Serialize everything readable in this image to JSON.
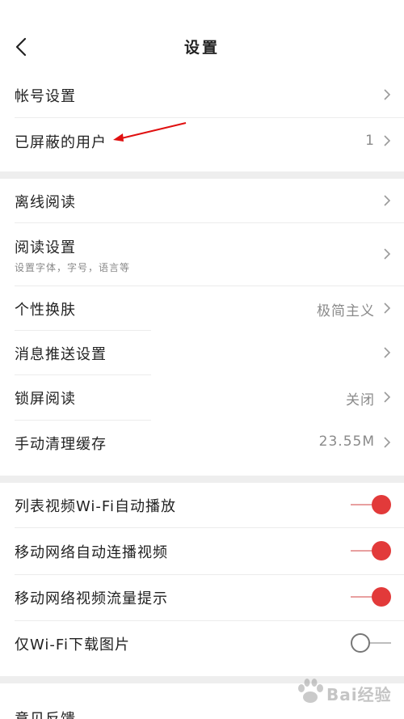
{
  "header": {
    "title": "设置"
  },
  "section1": [
    {
      "label": "帐号设置",
      "value": ""
    },
    {
      "label": "已屏蔽的用户",
      "value": "1"
    }
  ],
  "section2": [
    {
      "label": "离线阅读",
      "value": ""
    },
    {
      "label": "阅读设置",
      "sub": "设置字体，字号，语言等",
      "value": ""
    },
    {
      "label": "个性换肤",
      "value": "极简主义"
    },
    {
      "label": "消息推送设置",
      "value": ""
    },
    {
      "label": "锁屏阅读",
      "value": "关闭"
    },
    {
      "label": "手动清理缓存",
      "value": "23.55M"
    }
  ],
  "section3": [
    {
      "label": "列表视频Wi-Fi自动播放",
      "on": true
    },
    {
      "label": "移动网络自动连播视频",
      "on": true
    },
    {
      "label": "移动网络视频流量提示",
      "on": true
    },
    {
      "label": "仅Wi-Fi下载图片",
      "on": false
    }
  ],
  "section4": [
    {
      "label": "意见反馈"
    }
  ],
  "watermark": {
    "text": "Bai经验"
  },
  "colors": {
    "accent": "#e23a3a",
    "gap": "#eeeeee",
    "arrow": "#e01010"
  }
}
